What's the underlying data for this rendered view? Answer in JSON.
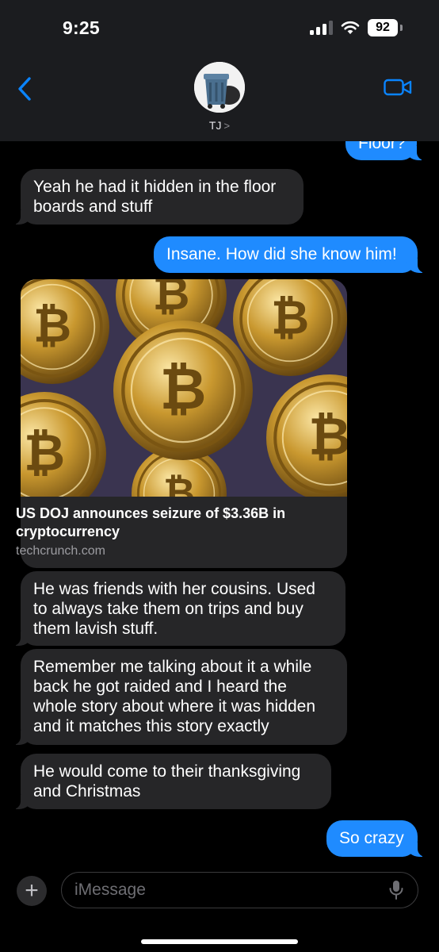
{
  "status_bar": {
    "time": "9:25",
    "battery": "92"
  },
  "header": {
    "contact_name": "TJ",
    "chevron": ">"
  },
  "messages": [
    {
      "from": "me",
      "text": "Floor?"
    },
    {
      "from": "them",
      "text": "Yeah he had it hidden in the floor boards and stuff"
    },
    {
      "from": "me",
      "text": "Insane. How did she know him!"
    },
    {
      "from": "them",
      "type": "link",
      "title": "US DOJ announces seizure of $3.36B in cryptocurrency",
      "domain": "techcrunch.com"
    },
    {
      "from": "them",
      "text": "He was friends with her cousins. Used to always take them on trips and buy them lavish stuff."
    },
    {
      "from": "them",
      "text": "Remember me talking about it a while back he got raided and I heard the whole story about where it was hidden and it matches this story exactly"
    },
    {
      "from": "them",
      "text": "He would come to their thanksgiving and Christmas"
    },
    {
      "from": "me",
      "text": "So crazy"
    }
  ],
  "input": {
    "placeholder": "iMessage",
    "value": ""
  },
  "colors": {
    "outgoing": "#1f8bff",
    "incoming": "#262628",
    "accent": "#0a84ff"
  }
}
